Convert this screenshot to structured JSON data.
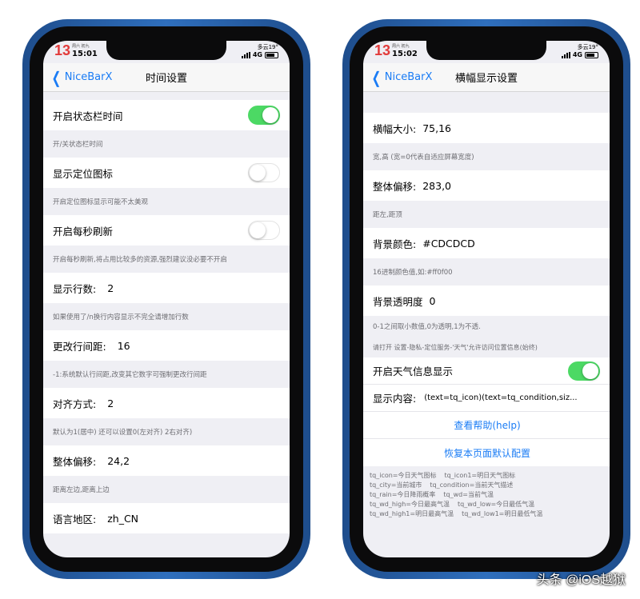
{
  "left": {
    "status": {
      "date": "13",
      "day": "周六 初九",
      "time": "15:01",
      "weather": "多云19°",
      "network": "4G"
    },
    "nav": {
      "back": "NiceBarX",
      "title": "时间设置"
    },
    "rows": [
      {
        "label": "开启状态栏时间",
        "toggle": true,
        "footer": "开/关状态栏时间"
      },
      {
        "label": "显示定位图标",
        "toggle": false,
        "footer": "开启定位图标显示可能不太美观"
      },
      {
        "label": "开启每秒刷新",
        "toggle": false,
        "footer": "开启每秒刷新,将占用比较多的资源,强烈建议没必要不开启"
      },
      {
        "label": "显示行数:",
        "value": "2",
        "footer": "如果使用了/n换行内容显示不完全请增加行数"
      },
      {
        "label": "更改行间距:",
        "value": "16",
        "footer": "-1:系统默认行间距,改变其它数字可强制更改行间距"
      },
      {
        "label": "对齐方式:",
        "value": "2",
        "footer": "默认为1(居中) 还可以设置0(左对齐) 2右对齐)"
      },
      {
        "label": "整体偏移:",
        "value": "24,2",
        "footer": "距离左边,距离上边"
      },
      {
        "label": "语言地区:",
        "value": "zh_CN"
      }
    ]
  },
  "right": {
    "status": {
      "date": "13",
      "day": "周六 初九",
      "time": "15:02",
      "weather": "多云19°",
      "network": "4G"
    },
    "nav": {
      "back": "NiceBarX",
      "title": "横幅显示设置"
    },
    "rows": [
      {
        "label": "横幅大小:",
        "value": "75,16",
        "footer": "宽,高 (宽=0代表自适应屏幕宽度)"
      },
      {
        "label": "整体偏移:",
        "value": "283,0",
        "footer": "距左,距顶"
      },
      {
        "label": "背景颜色:",
        "value": "#CDCDCD",
        "footer": "16进制颜色值,如:#ff0f00"
      },
      {
        "label": "背景透明度",
        "value": "0",
        "footer": "0-1之间取小数值,0为透明,1为不透."
      }
    ],
    "weather_note": "请打开 设置-隐私-定位服务-'天气'允许访问位置信息(始终)",
    "weather_toggle": {
      "label": "开启天气信息显示",
      "on": true
    },
    "display_content": {
      "label": "显示内容:",
      "value": "(text=tq_icon)(text=tq_condition,siz..."
    },
    "help_link": "查看帮助(help)",
    "reset_link": "恢复本页面默认配置",
    "legend": [
      [
        "tq_icon=今日天气图标",
        "tq_icon1=明日天气图标"
      ],
      [
        "tq_city=当前城市",
        "tq_condition=当前天气描述"
      ],
      [
        "tq_rain=今日降雨概率",
        "tq_wd=当前气温"
      ],
      [
        "tq_wd_high=今日最高气温",
        "tq_wd_low=今日最低气温"
      ],
      [
        "tq_wd_high1=明日最高气温",
        "tq_wd_low1=明日最低气温"
      ]
    ]
  },
  "watermark": "头条 @iOS越狱",
  "colors": {
    "accent": "#1a7cf5",
    "toggle_on": "#4cd964",
    "frame": "#2f6fbd",
    "date_red": "#e23b3b"
  }
}
